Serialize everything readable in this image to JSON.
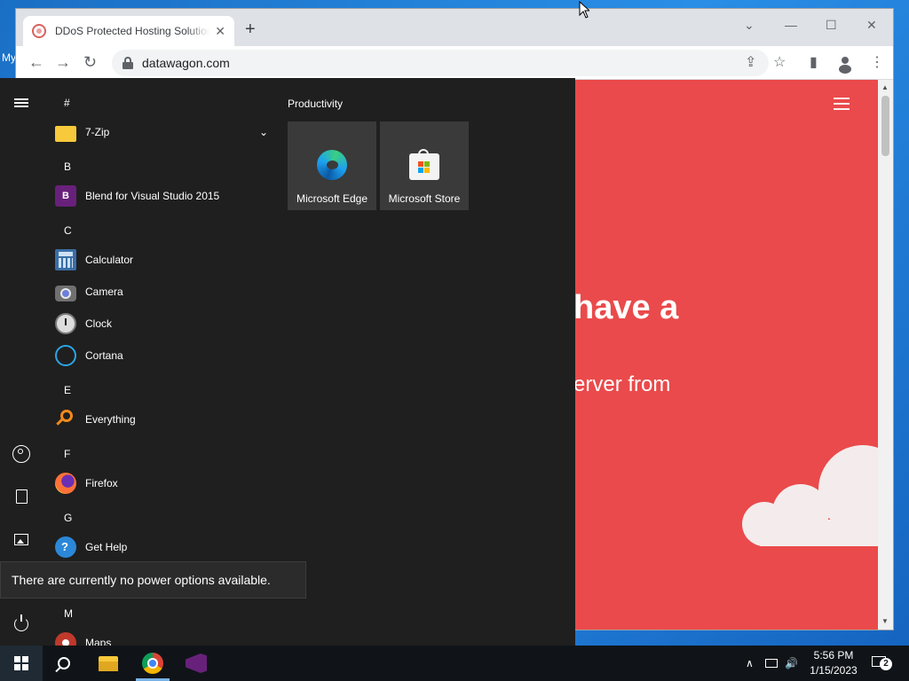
{
  "desktop": {
    "label": "My"
  },
  "browser": {
    "tab": {
      "title": "DDoS Protected Hosting Solutions",
      "close": "✕"
    },
    "new_tab": "+",
    "window_controls": {
      "tabsearch": "⌄",
      "minimize": "—",
      "maximize": "☐",
      "close": "✕"
    },
    "nav": {
      "back": "←",
      "forward": "→",
      "reload": "↻"
    },
    "url": "datawagon.com",
    "toolbar_icons": {
      "share": "⇪",
      "bookmark": "☆",
      "sidepanel": "▮",
      "menu": "⋮"
    },
    "page": {
      "hero_line1": "have a",
      "hero_line2": "erver from",
      "background": "#ea4a4b"
    }
  },
  "start_menu": {
    "groups": [
      {
        "letter": "#",
        "apps": [
          {
            "label": "7-Zip",
            "icon": "folder-icon",
            "expandable": true
          }
        ]
      },
      {
        "letter": "B",
        "apps": [
          {
            "label": "Blend for Visual Studio 2015",
            "icon": "blend-icon"
          }
        ]
      },
      {
        "letter": "C",
        "apps": [
          {
            "label": "Calculator",
            "icon": "calculator-icon"
          },
          {
            "label": "Camera",
            "icon": "camera-icon"
          },
          {
            "label": "Clock",
            "icon": "clock-icon"
          },
          {
            "label": "Cortana",
            "icon": "cortana-icon"
          }
        ]
      },
      {
        "letter": "E",
        "apps": [
          {
            "label": "Everything",
            "icon": "everything-icon"
          }
        ]
      },
      {
        "letter": "F",
        "apps": [
          {
            "label": "Firefox",
            "icon": "firefox-icon"
          }
        ]
      },
      {
        "letter": "G",
        "apps": [
          {
            "label": "Get Help",
            "icon": "get-help-icon"
          }
        ]
      },
      {
        "letter": "M",
        "apps": [
          {
            "label": "Maps",
            "icon": "maps-icon"
          }
        ]
      }
    ],
    "tile_group": {
      "title": "Productivity",
      "tiles": [
        {
          "label": "Microsoft Edge",
          "icon": "edge-icon"
        },
        {
          "label": "Microsoft Store",
          "icon": "store-icon"
        }
      ]
    },
    "power_tooltip": "There are currently no power options available."
  },
  "taskbar": {
    "time": "5:56 PM",
    "date": "1/15/2023",
    "notification_count": "2",
    "tray_chevron": "∧",
    "volume": "🔊"
  }
}
